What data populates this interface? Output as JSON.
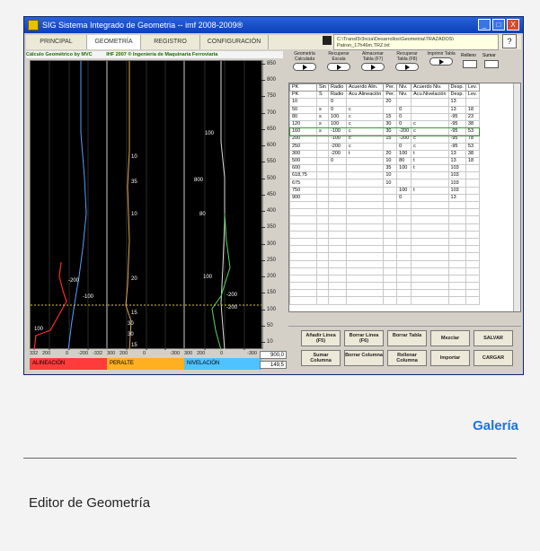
{
  "window": {
    "title": "SIG Sistema Integrado de Geometria  --  imf 2008-2009®",
    "minimize": "_",
    "maximize": "□",
    "close": "X"
  },
  "tabs": [
    "PRINCIPAL",
    "GEOMETRÍA",
    "REGISTRO",
    "CONFIGURACIÓN"
  ],
  "active_tab": "GEOMETRÍA",
  "file_path_line1": "C:\\Transf3r3ncia\\Desarrollos\\Geometria\\TRAZADOS\\",
  "file_path_line2": "Patron_17h46m.TRZ.txt",
  "calc_header_left": "Cálculo Geométrico by MVC",
  "calc_header_right": "IHF 2007 ® Ingeniería de Maquinaria Ferroviaria",
  "plots": [
    {
      "name": "ALINEACIÓN",
      "color": "#ff3b3b",
      "axis": [
        "332",
        "200",
        "0",
        "-200",
        "-332"
      ],
      "labels": [
        "-200",
        "-100",
        "100"
      ]
    },
    {
      "name": "PERALTE",
      "color": "#ffb020",
      "axis": [
        "300",
        "200",
        "0",
        "-300"
      ],
      "labels": [
        "10",
        "35",
        "10",
        "20",
        "15",
        "30",
        "30",
        "15"
      ]
    },
    {
      "name": "NIVELACIÓN",
      "color": "#4fc3ff",
      "axis": [
        "300",
        "200",
        "0",
        "-300"
      ],
      "labels": [
        "100",
        "800",
        "80",
        "100",
        "-200",
        "-200"
      ]
    }
  ],
  "ruler_ticks": [
    "850",
    "800",
    "750",
    "700",
    "650",
    "600",
    "550",
    "500",
    "450",
    "400",
    "350",
    "300",
    "250",
    "200",
    "150",
    "100",
    "50",
    "10"
  ],
  "ruler_values": [
    "900,0",
    "149,5"
  ],
  "toolbar": [
    {
      "label": "Geometría Calculada"
    },
    {
      "label": "Recuperar Escala"
    },
    {
      "label": "Almacenar Tabla (F7)"
    },
    {
      "label": "Recuperar Tabla (F8)"
    },
    {
      "label": "Imprimir Tabla"
    }
  ],
  "toolbar_right": [
    "Relleno",
    "Sumar"
  ],
  "table_header_1": [
    "PK",
    "Sin",
    "Radio",
    "Acuerdo Alin.",
    "Per.",
    "Niv.",
    "Acuerdo Niv.",
    "Desp.",
    "Lev."
  ],
  "table_header_2": [
    "PK",
    "S",
    "Radio",
    "Acu.Alineación",
    "Per.",
    "Niv.",
    "Acu.Nivelación",
    "Desp.",
    "Lev."
  ],
  "table_rows": [
    [
      "10",
      "",
      "0",
      "",
      "20",
      "",
      "",
      "13",
      ""
    ],
    [
      "50",
      "s",
      "0",
      "c",
      "",
      "0",
      "",
      "13",
      "18"
    ],
    [
      "80",
      "s",
      "100",
      "c",
      "15",
      "0",
      "",
      "-95",
      "23"
    ],
    [
      "120",
      "s",
      "100",
      "c",
      "30",
      "0",
      "c",
      "-95",
      "38"
    ],
    [
      "160",
      "s",
      "-100",
      "c",
      "30",
      "-200",
      "c",
      "-95",
      "53"
    ],
    [
      "200",
      "",
      "-100",
      "c",
      "15",
      "-200",
      "c",
      "-95",
      "78"
    ],
    [
      "250",
      "",
      "-200",
      "c",
      "",
      "0",
      "c",
      "-95",
      "53"
    ],
    [
      "300",
      "",
      "-200",
      "t",
      "20",
      "100",
      "t",
      "13",
      "38"
    ],
    [
      "500",
      "",
      "0",
      "",
      "10",
      "80",
      "t",
      "13",
      "18"
    ],
    [
      "600",
      "",
      "",
      "",
      "35",
      "100",
      "t",
      "103",
      ""
    ],
    [
      "618,75",
      "",
      "",
      "",
      "10",
      "",
      "",
      "103",
      ""
    ],
    [
      "675",
      "",
      "",
      "",
      "10",
      "",
      "",
      "103",
      ""
    ],
    [
      "750",
      "",
      "",
      "",
      "",
      "100",
      "t",
      "103",
      ""
    ],
    [
      "900",
      "",
      "",
      "",
      "",
      "0",
      "",
      "13",
      ""
    ]
  ],
  "buttons": [
    "Añadir Línea (F5)",
    "Borrar Línea (F6)",
    "Borrar Tabla",
    "Mezclar",
    "SALVAR",
    "Sumar Columna",
    "Borrar Columna",
    "Rellenar Columna",
    "Importar",
    "CARGAR"
  ],
  "gallery_link": "Galería",
  "caption": "Editor de Geometría"
}
